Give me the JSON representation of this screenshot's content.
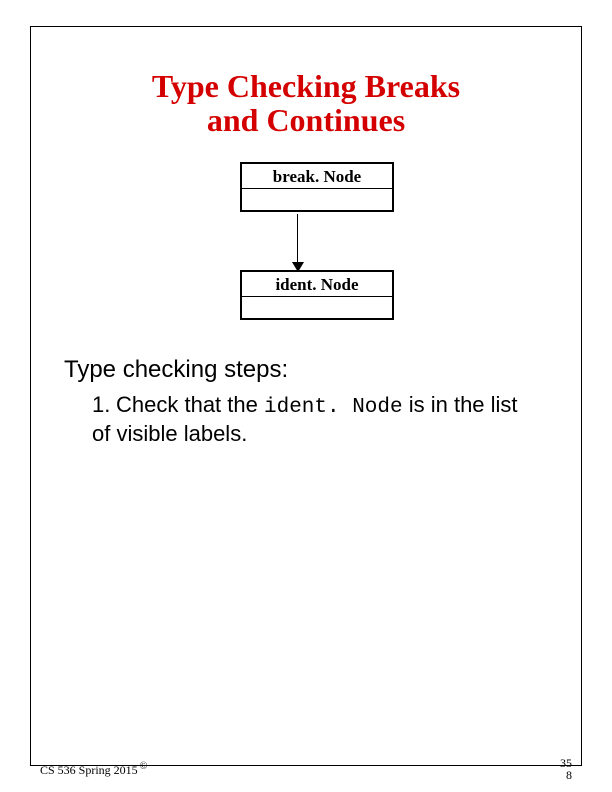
{
  "title_line1": "Type Checking Breaks",
  "title_line2": "and Continues",
  "node_break": "break. Node",
  "node_ident": "ident. Node",
  "subtitle": "Type checking steps:",
  "step1": {
    "num": "1.",
    "pre": "Check that the ",
    "code": "ident. Node",
    "post": " is in the list of visible labels."
  },
  "footer": {
    "course": "CS 536  Spring 2015",
    "copyright": "©",
    "page_a": "35",
    "page_b": "8"
  }
}
